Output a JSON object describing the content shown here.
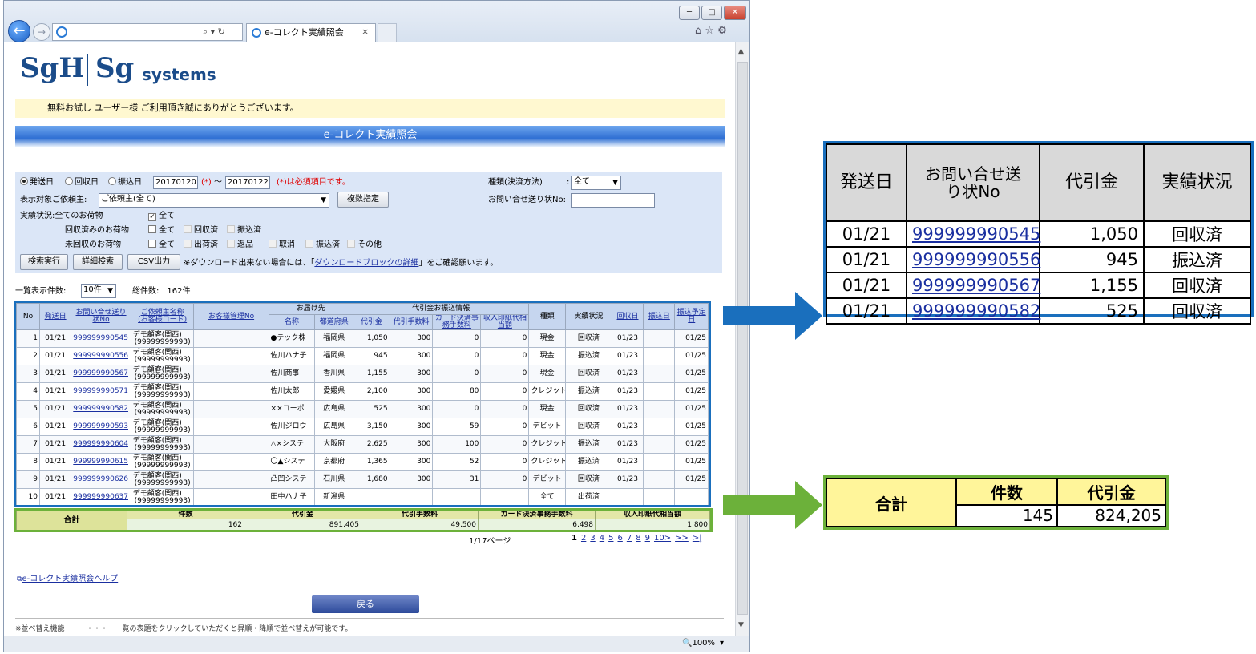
{
  "browser": {
    "tab_title": "e-コレクト実績照会",
    "zoom": "100%",
    "win_min": "─",
    "win_max": "□",
    "win_close": "✕",
    "back_glyph": "←",
    "forward_glyph": "→",
    "address_icons": "⌕ ▾ ↻",
    "tab_close": "×",
    "tools_glyphs": "⌂ ☆ ⚙",
    "zoom_prefix": "🔍",
    "zoom_caret": "▾"
  },
  "logo": {
    "brand1": "SgH",
    "brand2": "Sg",
    "brand2_suffix": "systems"
  },
  "banner": "無料お試し ユーザー様 ご利用頂き誠にありがとうございます。",
  "page_title": "e-コレクト実績照会",
  "form": {
    "radio_ship": "発送日",
    "radio_collect": "回収日",
    "radio_transfer": "振込日",
    "date_from": "20170120",
    "date_mark": "(*)",
    "date_sep": "〜",
    "date_to": "20170122",
    "required_note": "(*)は必須項目です。",
    "type_label": "種類(決済方法)",
    "type_colon": ":",
    "type_value": "全て",
    "client_label": "表示対象ご依頼主:",
    "client_value": "ご依頼主(全て)",
    "multi_button": "複数指定",
    "inquiry_label": "お問い合せ送り状No:",
    "status_label": "実績状況:全てのお荷物",
    "status_all": "全て",
    "collected_label": "回収済みのお荷物",
    "collected_opts": [
      "全て",
      "回収済",
      "振込済"
    ],
    "uncollected_label": "未回収のお荷物",
    "uncollected_opts": [
      "全て",
      "出荷済",
      "返品",
      "取消",
      "振込済",
      "その他"
    ],
    "search_button": "検索実行",
    "detail_button": "詳細検索",
    "csv_button": "CSV出力",
    "download_note_pre": "※ダウンロード出来ない場合には、「",
    "download_link": "ダウンロードブロックの詳細",
    "download_note_post": "」をご確認願います。"
  },
  "list_meta": {
    "per_page_label": "一覧表示件数:",
    "per_page_value": "10件",
    "total_label": "総件数:",
    "total_value": "162件"
  },
  "grid": {
    "headers": {
      "no": "No",
      "ship": "発送日",
      "inquiry": "お問い合せ送り状No",
      "client": "ご依頼主名称",
      "client_code": "(お客様コード)",
      "cust_mgmt": "お客様管理No",
      "dest_group": "お届け先",
      "dest_name": "名称",
      "dest_pref": "都道府県",
      "cod_group": "代引金お振込情報",
      "cod": "代引金",
      "cod_fee": "代引手数料",
      "card_fee": "カード決済事務手数料",
      "stamp": "収入印紙代相当額",
      "kind": "種類",
      "status": "実績状況",
      "collect": "回収日",
      "transfer": "振込日",
      "planned": "振込予定日"
    },
    "rows": [
      {
        "no": "1",
        "ship": "01/21",
        "inquiry": "999999990545",
        "client": "デモ顧客(関西)",
        "code": "(99999999993)",
        "mgmt": "",
        "name": "●テック株",
        "pref": "福岡県",
        "cod": "1,050",
        "fee": "300",
        "card": "0",
        "stamp": "0",
        "kind": "現金",
        "status": "回収済",
        "collect": "01/23",
        "transfer": "",
        "planned": "01/25"
      },
      {
        "no": "2",
        "ship": "01/21",
        "inquiry": "999999990556",
        "client": "デモ顧客(関西)",
        "code": "(99999999993)",
        "mgmt": "",
        "name": "佐川ハナ子",
        "pref": "福岡県",
        "cod": "945",
        "fee": "300",
        "card": "0",
        "stamp": "0",
        "kind": "現金",
        "status": "振込済",
        "collect": "01/23",
        "transfer": "",
        "planned": "01/25"
      },
      {
        "no": "3",
        "ship": "01/21",
        "inquiry": "999999990567",
        "client": "デモ顧客(関西)",
        "code": "(99999999993)",
        "mgmt": "",
        "name": "佐川商事",
        "pref": "香川県",
        "cod": "1,155",
        "fee": "300",
        "card": "0",
        "stamp": "0",
        "kind": "現金",
        "status": "回収済",
        "collect": "01/23",
        "transfer": "",
        "planned": "01/25"
      },
      {
        "no": "4",
        "ship": "01/21",
        "inquiry": "999999990571",
        "client": "デモ顧客(関西)",
        "code": "(99999999993)",
        "mgmt": "",
        "name": "佐川太郎",
        "pref": "愛媛県",
        "cod": "2,100",
        "fee": "300",
        "card": "80",
        "stamp": "0",
        "kind": "クレジット",
        "status": "振込済",
        "collect": "01/23",
        "transfer": "",
        "planned": "01/25"
      },
      {
        "no": "5",
        "ship": "01/21",
        "inquiry": "999999990582",
        "client": "デモ顧客(関西)",
        "code": "(99999999993)",
        "mgmt": "",
        "name": "××コーポ",
        "pref": "広島県",
        "cod": "525",
        "fee": "300",
        "card": "0",
        "stamp": "0",
        "kind": "現金",
        "status": "回収済",
        "collect": "01/23",
        "transfer": "",
        "planned": "01/25"
      },
      {
        "no": "6",
        "ship": "01/21",
        "inquiry": "999999990593",
        "client": "デモ顧客(関西)",
        "code": "(99999999993)",
        "mgmt": "",
        "name": "佐川ジロウ",
        "pref": "広島県",
        "cod": "3,150",
        "fee": "300",
        "card": "59",
        "stamp": "0",
        "kind": "デビット",
        "status": "回収済",
        "collect": "01/23",
        "transfer": "",
        "planned": "01/25"
      },
      {
        "no": "7",
        "ship": "01/21",
        "inquiry": "999999990604",
        "client": "デモ顧客(関西)",
        "code": "(99999999993)",
        "mgmt": "",
        "name": "△×システ",
        "pref": "大阪府",
        "cod": "2,625",
        "fee": "300",
        "card": "100",
        "stamp": "0",
        "kind": "クレジット",
        "status": "振込済",
        "collect": "01/23",
        "transfer": "",
        "planned": "01/25"
      },
      {
        "no": "8",
        "ship": "01/21",
        "inquiry": "999999990615",
        "client": "デモ顧客(関西)",
        "code": "(99999999993)",
        "mgmt": "",
        "name": "〇▲システ",
        "pref": "京都府",
        "cod": "1,365",
        "fee": "300",
        "card": "52",
        "stamp": "0",
        "kind": "クレジット",
        "status": "振込済",
        "collect": "01/23",
        "transfer": "",
        "planned": "01/25"
      },
      {
        "no": "9",
        "ship": "01/21",
        "inquiry": "999999990626",
        "client": "デモ顧客(関西)",
        "code": "(99999999993)",
        "mgmt": "",
        "name": "凸凹システ",
        "pref": "石川県",
        "cod": "1,680",
        "fee": "300",
        "card": "31",
        "stamp": "0",
        "kind": "デビット",
        "status": "回収済",
        "collect": "01/23",
        "transfer": "",
        "planned": "01/25"
      },
      {
        "no": "10",
        "ship": "01/21",
        "inquiry": "999999990637",
        "client": "デモ顧客(関西)",
        "code": "(99999999993)",
        "mgmt": "",
        "name": "田中ハナ子",
        "pref": "新潟県",
        "cod": "",
        "fee": "",
        "card": "",
        "stamp": "",
        "kind": "全て",
        "status": "出荷済",
        "collect": "",
        "transfer": "",
        "planned": ""
      }
    ]
  },
  "totals": {
    "label": "合計",
    "headers": [
      "件数",
      "代引金",
      "代引手数料",
      "カード決済事務手数料",
      "収入印紙代相当額"
    ],
    "values": [
      "162",
      "891,405",
      "49,500",
      "6,498",
      "1,800"
    ]
  },
  "pager": {
    "summary": "1/17ページ",
    "pages": [
      "1",
      "2",
      "3",
      "4",
      "5",
      "6",
      "7",
      "8",
      "9",
      "10>",
      ">>",
      ">|"
    ]
  },
  "help_link": "e-コレクト実績照会ヘルプ",
  "back_button": "戻る",
  "footer_note": "※並べ替え機能　　　・・・　一覧の表題をクリックしていただくと昇順・降順で並べ替えが可能です。",
  "callout_grid": {
    "headers": [
      "発送日",
      "お問い合せ送り状No",
      "代引金",
      "実績状況"
    ],
    "rows": [
      [
        "01/21",
        "999999990545",
        "1,050",
        "回収済"
      ],
      [
        "01/21",
        "999999990556",
        "945",
        "振込済"
      ],
      [
        "01/21",
        "999999990567",
        "1,155",
        "回収済"
      ],
      [
        "01/21",
        "999999990582",
        "525",
        "回収済"
      ]
    ]
  },
  "callout_totals": {
    "label": "合計",
    "count_header": "件数",
    "cod_header": "代引金",
    "count_value": "145",
    "cod_value": "824,205"
  },
  "colors": {
    "blue_frame": "#1a6fbd",
    "green_frame": "#6cb13a",
    "banner": "#fff8d0"
  }
}
